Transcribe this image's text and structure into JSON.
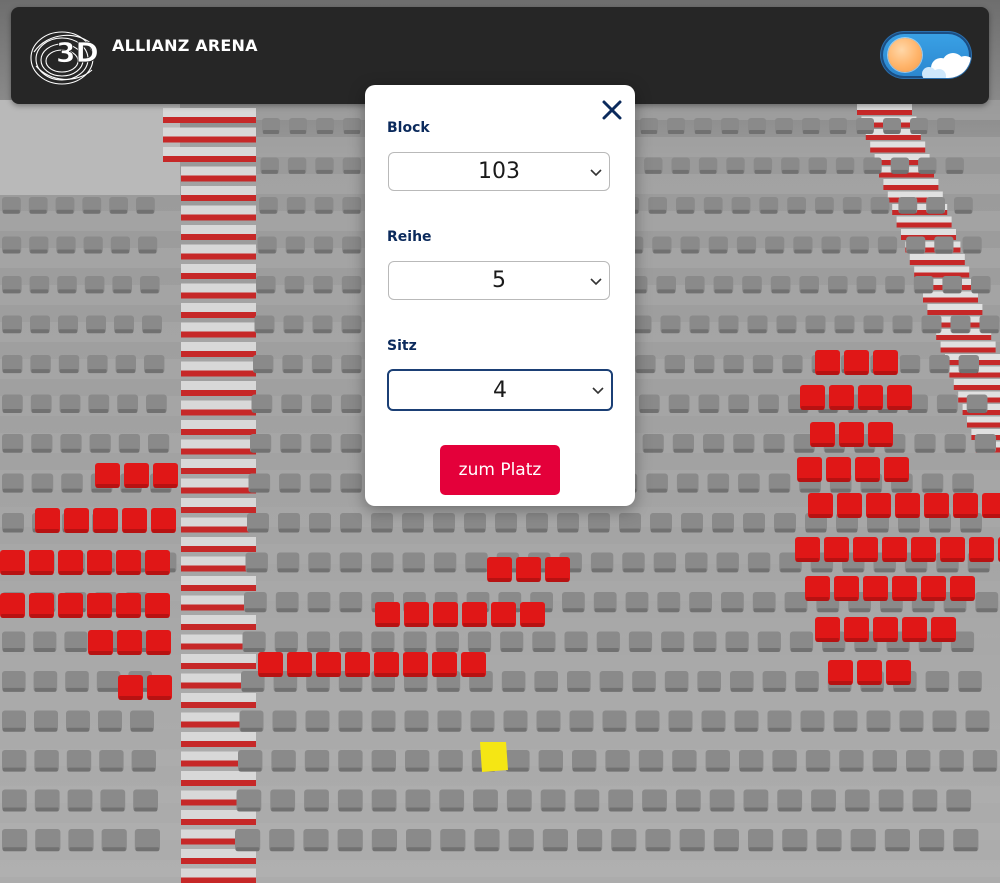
{
  "header": {
    "logo_text": "3D",
    "title": "ALLIANZ ARENA"
  },
  "theme_toggle": {
    "state": "day",
    "colors": {
      "track": "#3aa2e6",
      "knob": "#ffb46a"
    }
  },
  "seat_selector": {
    "block_label": "Block",
    "block_value": "103",
    "row_label": "Reihe",
    "row_value": "5",
    "seat_label": "Sitz",
    "seat_value": "4",
    "submit_label": "zum Platz",
    "close_icon": "close-icon"
  },
  "colors": {
    "brand_red": "#e4003a",
    "label_navy": "#0b2a5c",
    "seat_grey": "#8a8a8a",
    "seat_red": "#e01717",
    "seat_selected": "#f5e614",
    "header_bg": "#262626"
  },
  "scene": {
    "description_icon": "stadium-seating-3d-view",
    "selected_seat": {
      "block": "103",
      "row": "5",
      "seat": "4"
    }
  }
}
